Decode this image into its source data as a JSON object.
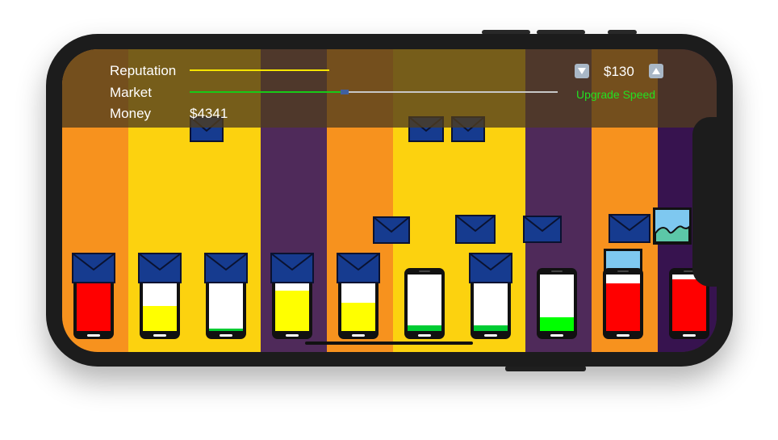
{
  "hud": {
    "reputation_label": "Reputation",
    "market_label": "Market",
    "money_label": "Money",
    "money_value": "$4341",
    "price_value": "$130",
    "upgrade_label": "Upgrade Speed",
    "reputation_level": 0.38,
    "market_level": 0.42
  },
  "lanes": [
    {
      "color": "#f7921e"
    },
    {
      "color": "#fcd20f"
    },
    {
      "color": "#fcd20f"
    },
    {
      "color": "#4f2a5a"
    },
    {
      "color": "#f7921e"
    },
    {
      "color": "#fcd20f"
    },
    {
      "color": "#fcd20f"
    },
    {
      "color": "#4f2a5a"
    },
    {
      "color": "#f7921e"
    },
    {
      "color": "#37134f"
    }
  ],
  "phones": [
    {
      "fill": 1.0,
      "color": "#ff0000",
      "envelope": true
    },
    {
      "fill": 0.45,
      "color": "#ffff00",
      "envelope": true
    },
    {
      "fill": 0.05,
      "color": "#00cc33",
      "envelope": true
    },
    {
      "fill": 0.72,
      "color": "#ffff00",
      "envelope": true
    },
    {
      "fill": 0.5,
      "color": "#ffff00",
      "envelope": true
    },
    {
      "fill": 0.1,
      "color": "#00cc33",
      "envelope": false
    },
    {
      "fill": 0.1,
      "color": "#00cc33",
      "envelope": true
    },
    {
      "fill": 0.25,
      "color": "#00ff00",
      "envelope": false
    },
    {
      "fill": 0.85,
      "color": "#ff0000",
      "envelope": false
    },
    {
      "fill": 0.92,
      "color": "#ff0000",
      "envelope": false
    }
  ],
  "colors": {
    "envelope": "#163b8f",
    "envelope_edge": "#0a1230",
    "picture_sky": "#7ec8f0",
    "picture_hill": "#5cc7a8"
  },
  "icons": [
    "envelope-icon",
    "picture-icon",
    "chevron-down-icon",
    "chevron-up-icon"
  ]
}
